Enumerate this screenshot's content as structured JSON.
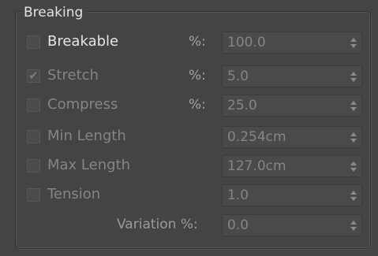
{
  "group": {
    "title": "Breaking"
  },
  "rows": [
    {
      "label": "Breakable",
      "checked": false,
      "percent_label": "%:",
      "value": "100.0"
    },
    {
      "label": "Stretch",
      "checked": true,
      "percent_label": "%:",
      "value": "5.0"
    },
    {
      "label": "Compress",
      "checked": false,
      "percent_label": "%:",
      "value": "25.0"
    },
    {
      "label": "Min Length",
      "checked": false,
      "value": "0.254cm"
    },
    {
      "label": "Max Length",
      "checked": false,
      "value": "127.0cm"
    },
    {
      "label": "Tension",
      "checked": false,
      "value": "1.0"
    }
  ],
  "variation": {
    "label": "Variation %:",
    "value": "0.0"
  },
  "icons": {
    "check": "check-icon",
    "spinner": "spinner-arrows-icon"
  },
  "colors": {
    "background": "#444444",
    "active_text": "#e6e6e6",
    "disabled_text": "#858585",
    "field_background": "#4a4a4a"
  }
}
